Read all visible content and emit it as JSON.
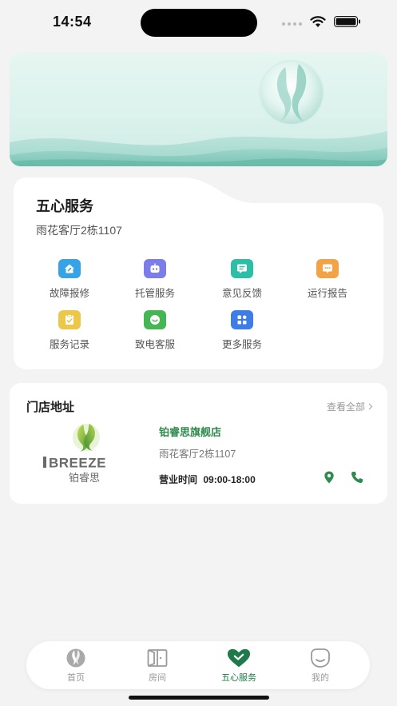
{
  "status_bar": {
    "time": "14:54",
    "wifi_icon": "wifi-icon",
    "battery_icon": "battery-icon"
  },
  "banner": {
    "icon": "breeze-emblem"
  },
  "service": {
    "title": "五心服务",
    "subtitle": "雨花客厅2栋1107",
    "items": [
      {
        "label": "故障报修",
        "icon": "repair-house-icon",
        "color": "#36a3e6"
      },
      {
        "label": "托管服务",
        "icon": "robot-icon",
        "color": "#7b7ee8"
      },
      {
        "label": "意见反馈",
        "icon": "feedback-icon",
        "color": "#2cbfa7"
      },
      {
        "label": "运行报告",
        "icon": "report-chat-icon",
        "color": "#f3a245"
      },
      {
        "label": "服务记录",
        "icon": "clipboard-check-icon",
        "color": "#ecc84a"
      },
      {
        "label": "致电客服",
        "icon": "smile-chat-icon",
        "color": "#45b653"
      },
      {
        "label": "更多服务",
        "icon": "grid-more-icon",
        "color": "#3e7ce8"
      }
    ]
  },
  "store": {
    "heading": "门店地址",
    "view_all": "查看全部",
    "logo": {
      "brand": "IBREEZE",
      "brand_cn": "铂睿思"
    },
    "name": "铂睿思旗舰店",
    "address": "雨花客厅2栋1107",
    "hours_label": "营业时间",
    "hours": "09:00-18:00",
    "accent": "#2e8b4b"
  },
  "tabs": [
    {
      "label": "首页",
      "icon": "home-emblem-icon",
      "active": false
    },
    {
      "label": "房间",
      "icon": "door-icon",
      "active": false
    },
    {
      "label": "五心服务",
      "icon": "heart-check-icon",
      "active": true
    },
    {
      "label": "我的",
      "icon": "profile-smile-icon",
      "active": false
    }
  ],
  "colors": {
    "brand_green": "#1f7a49",
    "background": "#f2f3f2"
  }
}
